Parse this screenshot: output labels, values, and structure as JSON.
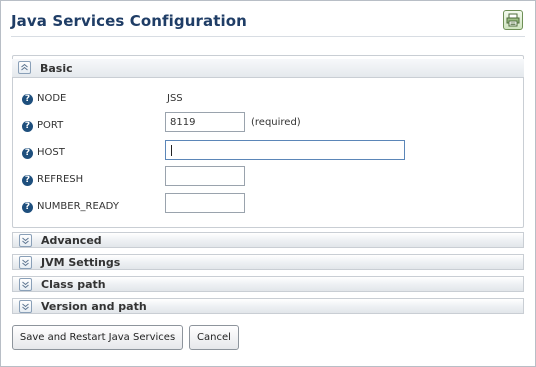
{
  "page": {
    "title": "Java Services Configuration",
    "print_icon": "printer-icon"
  },
  "sections": {
    "basic": {
      "label": "Basic",
      "state": "expanded",
      "icon": "chevron-up-icon"
    },
    "advanced": {
      "label": "Advanced",
      "state": "collapsed",
      "icon": "chevron-down-icon"
    },
    "jvm": {
      "label": "JVM Settings",
      "state": "collapsed",
      "icon": "chevron-down-icon"
    },
    "classpath": {
      "label": "Class path",
      "state": "collapsed",
      "icon": "chevron-down-icon"
    },
    "version": {
      "label": "Version and path",
      "state": "collapsed",
      "icon": "chevron-down-icon"
    }
  },
  "fields": {
    "node": {
      "label": "NODE",
      "value": "JSS"
    },
    "port": {
      "label": "PORT",
      "value": "8119",
      "hint": "(required)"
    },
    "host": {
      "label": "HOST",
      "value": ""
    },
    "refresh": {
      "label": "REFRESH",
      "value": ""
    },
    "number_ready": {
      "label": "NUMBER_READY",
      "value": ""
    }
  },
  "help_icon": "help-icon",
  "buttons": {
    "save": "Save and Restart Java Services",
    "cancel": "Cancel"
  },
  "colors": {
    "title": "#1f3d66",
    "help_icon": "#1e4f7d",
    "print_icon": "#6e8f56"
  }
}
